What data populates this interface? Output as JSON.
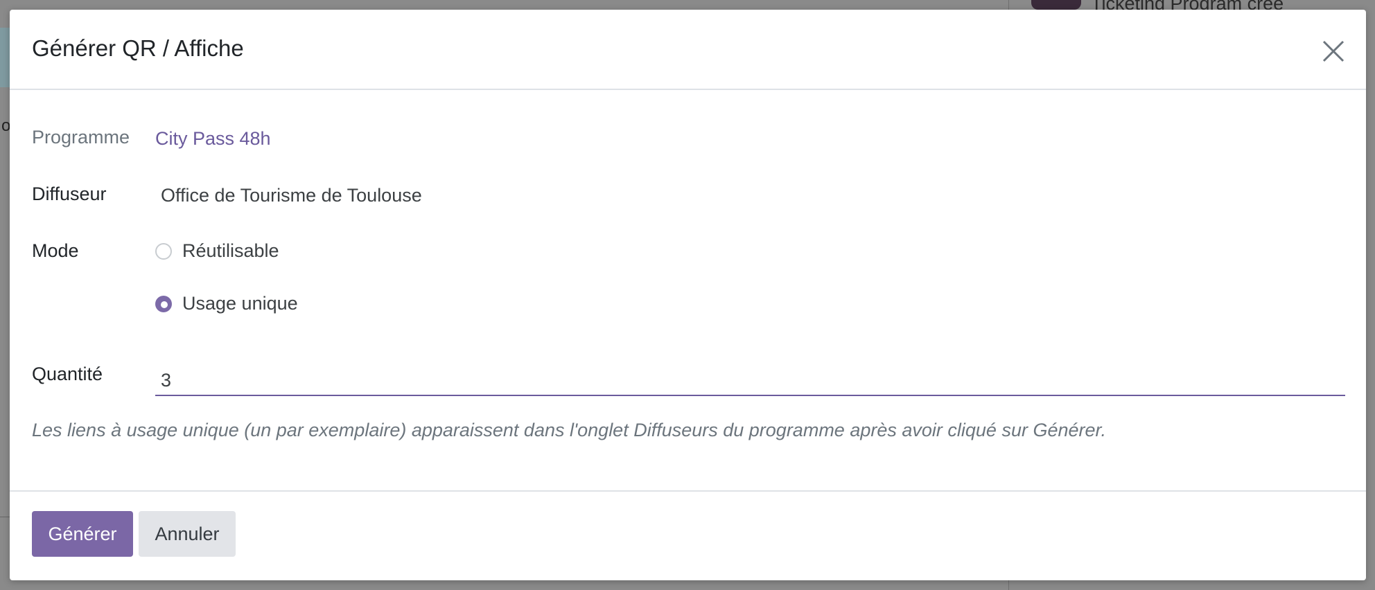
{
  "background": {
    "left_fragment": "o",
    "right_item_text": "Ticketing Program créé"
  },
  "dialog": {
    "title": "Générer QR / Affiche",
    "close_icon": "close-icon",
    "fields": {
      "programme": {
        "label": "Programme",
        "value": "City Pass 48h"
      },
      "diffuseur": {
        "label": "Diffuseur",
        "value": "Office de Tourisme de Toulouse"
      },
      "mode": {
        "label": "Mode",
        "options": [
          {
            "label": "Réutilisable",
            "selected": false
          },
          {
            "label": "Usage unique",
            "selected": true
          }
        ]
      },
      "quantite": {
        "label": "Quantité",
        "value": "3"
      }
    },
    "hint": "Les liens à usage unique (un par exemplaire) apparaissent dans l'onglet Diffuseurs du programme après avoir cliqué sur Générer.",
    "buttons": {
      "primary": "Générer",
      "secondary": "Annuler"
    }
  },
  "colors": {
    "accent": "#7b67a6",
    "link": "#6a5a9c",
    "overlay": "#8a8a8a"
  }
}
